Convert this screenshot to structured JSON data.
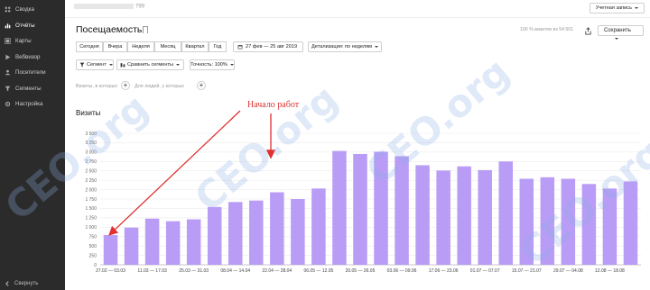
{
  "sidebar": {
    "items": [
      {
        "label": "Сводка",
        "icon": "grid-icon"
      },
      {
        "label": "Отчёты",
        "icon": "bar-chart-icon"
      },
      {
        "label": "Карты",
        "icon": "map-icon"
      },
      {
        "label": "Вебвизор",
        "icon": "play-icon"
      },
      {
        "label": "Посетители",
        "icon": "users-icon"
      },
      {
        "label": "Сегменты",
        "icon": "funnel-icon"
      },
      {
        "label": "Настройка",
        "icon": "gear-icon"
      }
    ],
    "collapse_label": "Свернуть"
  },
  "topbar": {
    "counter_suffix": "799",
    "account_label": "Учетная запись"
  },
  "header": {
    "title": "Посещаемость",
    "visits_info": "100 % визитов из 54 501",
    "save_label": "Сохранить"
  },
  "periods": [
    "Сегодня",
    "Вчера",
    "Неделя",
    "Месяц",
    "Квартал",
    "Год"
  ],
  "date_range": "27 фев — 25 авг 2019",
  "detail_label": "Детализация: по неделям",
  "segment_label": "Сегмент",
  "compare_label": "Сравнить сегменты",
  "accuracy_label": "Точность: 100%",
  "filters": {
    "visits_label": "Визиты, в которых",
    "users_label": "Для людей, у которых"
  },
  "chart_section_title": "Визиты",
  "annotation_text": "Начало работ",
  "colors": {
    "bar": "#b99cf5",
    "sidebar_bg": "#2b2b2b",
    "annotation": "#e03030"
  },
  "chart_data": {
    "type": "bar",
    "series": [
      {
        "name": "Визиты",
        "values": [
          790,
          990,
          1230,
          1160,
          1210,
          1540,
          1670,
          1710,
          1930,
          1750,
          2030,
          3030,
          2950,
          3010,
          2890,
          2650,
          2510,
          2620,
          2520,
          2750,
          2290,
          2330,
          2290,
          2150,
          2030,
          2220
        ]
      }
    ],
    "x_tick_labels": [
      "27.02 — 03.03",
      "11.03 — 17.03",
      "25.03 — 31.03",
      "08.04 — 14.04",
      "22.04 — 28.04",
      "06.05 — 12.05",
      "20.05 — 26.05",
      "03.06 — 09.06",
      "17.06 — 23.06",
      "01.07 — 07.07",
      "15.07 — 21.07",
      "29.07 — 04.08",
      "12.08 — 18.08"
    ],
    "y_ticks": [
      "0",
      "250",
      "500",
      "750",
      "1 000",
      "1 250",
      "1 500",
      "1 750",
      "2 000",
      "2 250",
      "2 500",
      "2 750",
      "3 000",
      "3 250",
      "3 500"
    ],
    "ylim": [
      0,
      3500
    ]
  },
  "watermarks": [
    "CEO.org",
    "CEO.org",
    "CEO.org",
    "CEO.org"
  ]
}
